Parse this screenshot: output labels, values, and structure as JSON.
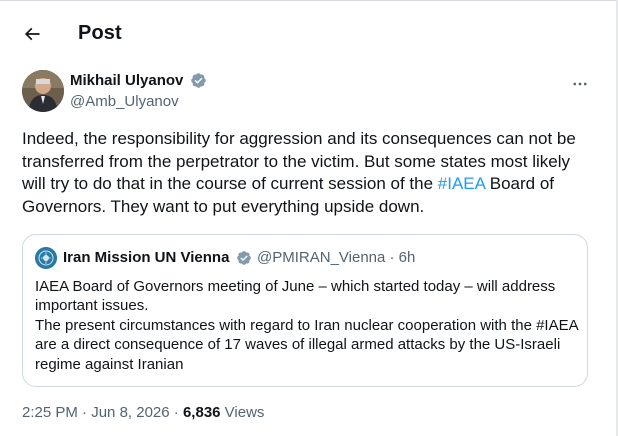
{
  "header": {
    "title": "Post"
  },
  "author": {
    "name": "Mikhail Ulyanov",
    "handle": "@Amb_Ulyanov"
  },
  "tweet": {
    "text_before": "Indeed, the responsibility for aggression and its consequences can not be transferred from the perpetrator to the victim. But some states most likely will try to do that in the course of current session of the ",
    "hashtag": "#IAEA",
    "text_after": " Board of Governors. They want to put everything upside down."
  },
  "quote": {
    "name": "Iran Mission UN Vienna",
    "handle": "@PMIRAN_Vienna · 6h",
    "line1": "IAEA Board of Governors meeting of June – which started today – will address important issues.",
    "line2": "The present circumstances with regard to Iran nuclear cooperation with the #IAEA are a direct consequence of 17 waves of illegal armed attacks by the US-Israeli regime against Iranian"
  },
  "meta": {
    "time": "2:25 PM",
    "sep": " · ",
    "date": "Jun 8, 2026",
    "sep2": " · ",
    "views": "6,836",
    "views_label": " Views"
  },
  "colors": {
    "accent": "#1d9bf0",
    "text": "#0f1419",
    "secondary": "#536471",
    "border": "#cfd9de"
  },
  "icons": {
    "back": "back-arrow-icon",
    "verified": "verified-badge-icon",
    "more": "more-icon"
  }
}
